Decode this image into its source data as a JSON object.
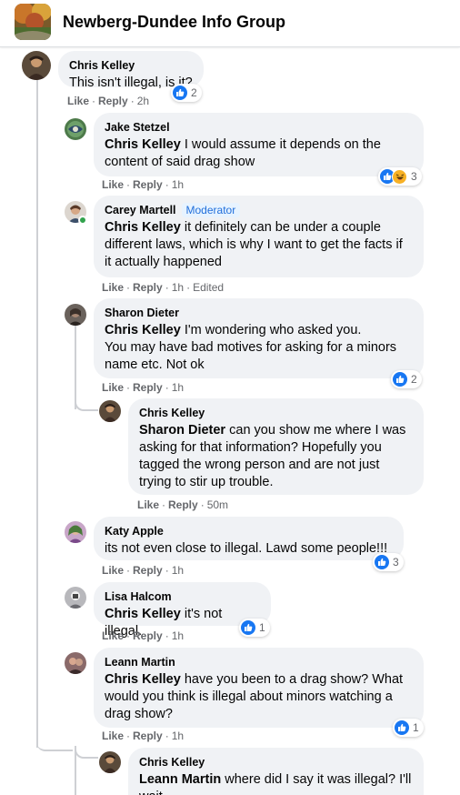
{
  "group": {
    "title": "Newberg-Dundee Info Group"
  },
  "colors": {
    "like_blue": "#1877f2",
    "haha_yellow": "#f7b125",
    "bubble": "#f0f2f5",
    "meta_text": "#65676b",
    "moderator": "#216fdb"
  },
  "actions": {
    "like": "Like",
    "reply": "Reply",
    "separator": "·"
  },
  "comments": [
    {
      "author": "Chris Kelley",
      "mention": "",
      "text": "This isn't illegal, is it?",
      "time": "2h",
      "reactions": [
        "like-icon"
      ],
      "reaction_count": "2"
    },
    {
      "author": "Jake Stetzel",
      "mention": "Chris Kelley",
      "text": "I would assume it depends on the content of said drag show",
      "time": "1h",
      "reactions": [
        "like-icon",
        "haha-icon"
      ],
      "reaction_count": "3"
    },
    {
      "author": "Carey Martell",
      "badge": "Moderator",
      "mention": "Chris Kelley",
      "text": "it definitely can be under a couple different laws, which is why I want to get the facts if it actually happened",
      "time": "1h",
      "edited": "Edited",
      "reactions": [],
      "reaction_count": ""
    },
    {
      "author": "Sharon Dieter",
      "mention": "Chris Kelley",
      "text": "I'm wondering who asked you.",
      "text2": "You may have bad motives for asking for a minors name etc. Not ok",
      "time": "1h",
      "reactions": [
        "like-icon"
      ],
      "reaction_count": "2"
    },
    {
      "author": "Chris Kelley",
      "mention": "Sharon Dieter",
      "text": "can you show me where I was asking for that information? Hopefully you tagged the wrong person and are not just trying to stir up trouble.",
      "time": "50m",
      "reactions": [],
      "reaction_count": ""
    },
    {
      "author": "Katy Apple",
      "mention": "",
      "text": "its not even close to illegal. Lawd some people!!!",
      "time": "1h",
      "reactions": [
        "like-icon"
      ],
      "reaction_count": "3"
    },
    {
      "author": "Lisa Halcom",
      "mention": "Chris Kelley",
      "text": "it's not illegal.",
      "time": "1h",
      "reactions": [
        "like-icon"
      ],
      "reaction_count": "1"
    },
    {
      "author": "Leann Martin",
      "mention": "Chris Kelley",
      "text": "have you been to a drag show? What would you think is illegal about minors watching a drag show?",
      "time": "1h",
      "reactions": [
        "like-icon"
      ],
      "reaction_count": "1"
    },
    {
      "author": "Chris Kelley",
      "mention": "Leann Martin",
      "text": "where did I say it was illegal? I'll wait.",
      "time": "",
      "reactions": [],
      "reaction_count": ""
    }
  ]
}
